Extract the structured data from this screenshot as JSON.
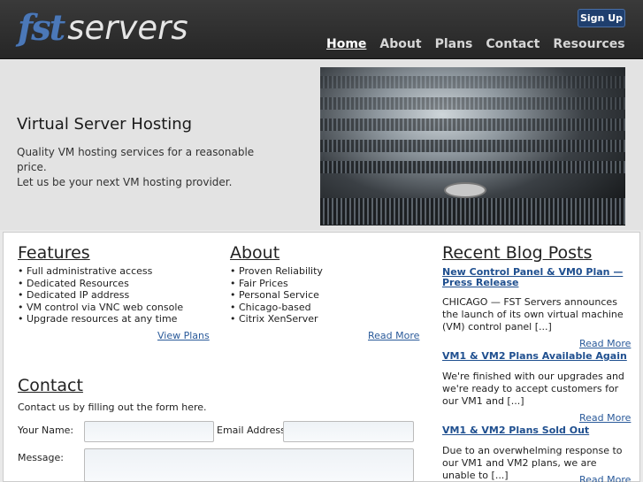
{
  "header": {
    "logo_part1": "fst",
    "logo_part2": "servers",
    "signup_label": "Sign Up",
    "nav": [
      "Home",
      "About",
      "Plans",
      "Contact",
      "Resources"
    ]
  },
  "hero": {
    "title": "Virtual Server Hosting",
    "tagline_line1": "Quality VM hosting services for a reasonable price.",
    "tagline_line2": "Let us be your next VM hosting provider."
  },
  "features": {
    "heading": "Features",
    "items": [
      "Full administrative access",
      "Dedicated Resources",
      "Dedicated IP address",
      "VM control via VNC web console",
      "Upgrade resources at any time"
    ],
    "link": "View Plans"
  },
  "about": {
    "heading": "About",
    "items": [
      "Proven Reliability",
      "Fair Prices",
      "Personal Service",
      "Chicago-based",
      "Citrix XenServer"
    ],
    "link": "Read More"
  },
  "blog": {
    "heading": "Recent Blog Posts",
    "posts": [
      {
        "title": "New Control Panel & VM0 Plan — Press Release",
        "body": "CHICAGO — FST Servers announces the launch of its own virtual machine (VM) control panel [...]",
        "more": "Read More"
      },
      {
        "title": "VM1 & VM2 Plans Available Again",
        "body": "We're finished with our upgrades and we're ready to accept customers for our VM1 and [...]",
        "more": "Read More"
      },
      {
        "title": "VM1 & VM2 Plans Sold Out",
        "body": "Due to an overwhelming response to our VM1 and VM2 plans, we are unable to [...]",
        "more": "Read More"
      }
    ]
  },
  "contact": {
    "heading": "Contact",
    "intro": "Contact us by filling out the form here.",
    "name_label": "Your Name:",
    "email_label": "Email Address:",
    "message_label": "Message:"
  }
}
